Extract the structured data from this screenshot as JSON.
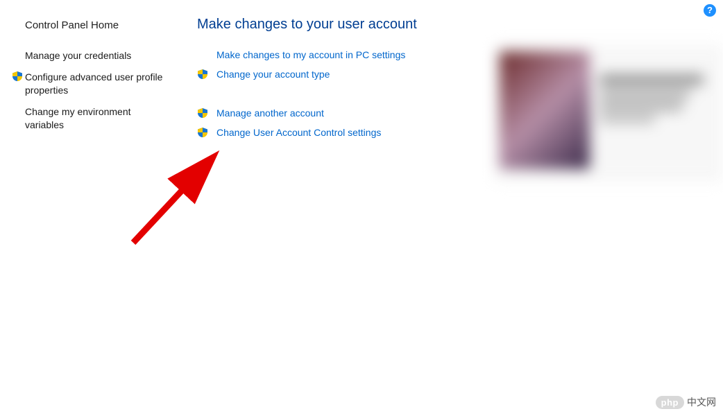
{
  "help_tooltip": "?",
  "sidebar": {
    "home": "Control Panel Home",
    "items": [
      {
        "label": "Manage your credentials",
        "has_shield": false
      },
      {
        "label": "Configure advanced user profile properties",
        "has_shield": true
      },
      {
        "label": "Change my environment variables",
        "has_shield": false
      }
    ]
  },
  "main": {
    "title": "Make changes to your user account",
    "actions_top": [
      {
        "label": "Make changes to my account in PC settings",
        "has_shield": false
      },
      {
        "label": "Change your account type",
        "has_shield": true
      }
    ],
    "actions_bottom": [
      {
        "label": "Manage another account",
        "has_shield": true
      },
      {
        "label": "Change User Account Control settings",
        "has_shield": true
      }
    ]
  },
  "watermark": {
    "badge": "php",
    "text": "中文网"
  }
}
